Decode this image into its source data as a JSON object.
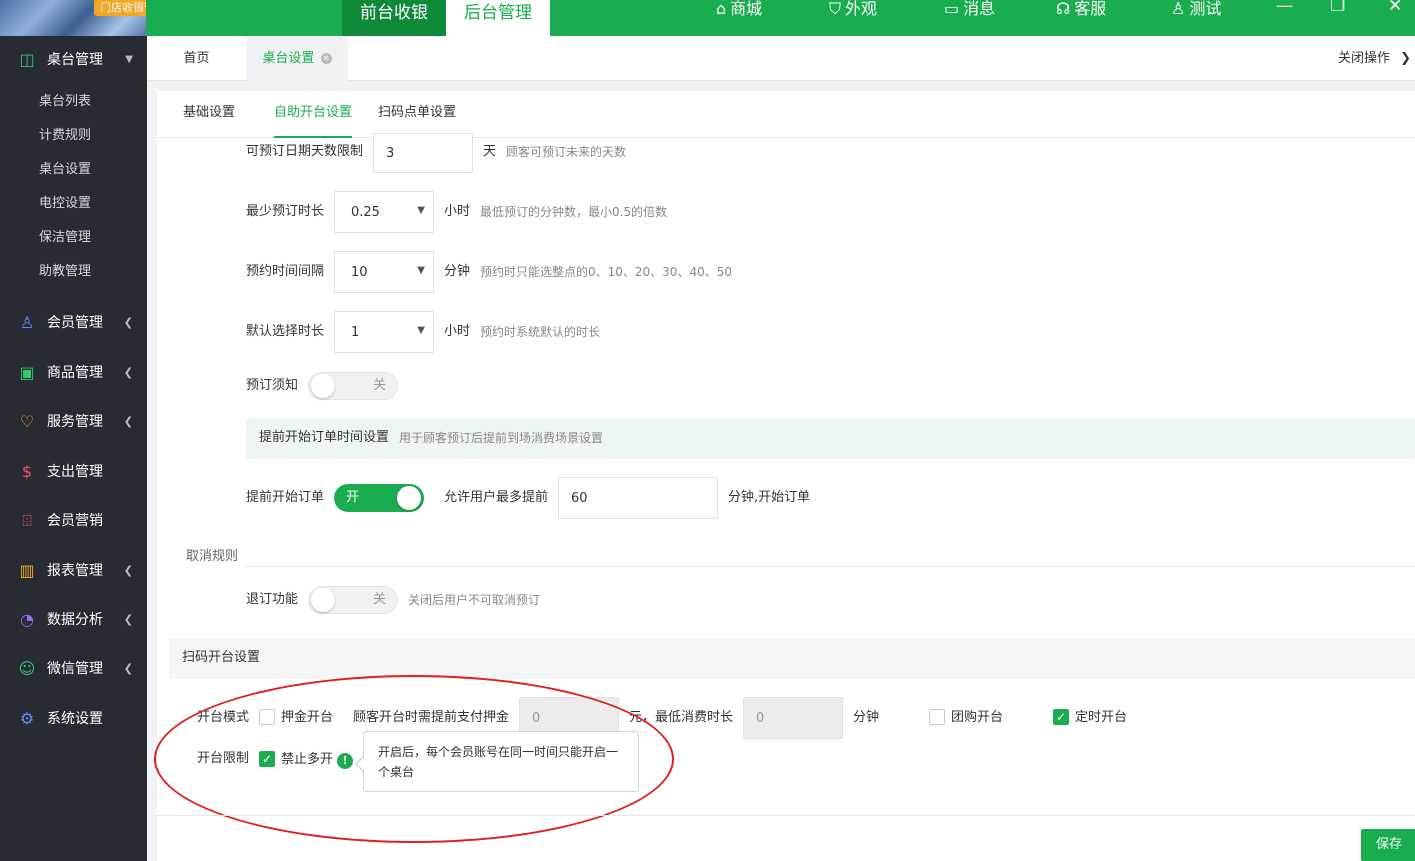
{
  "topbar": {
    "logo_text": "门店收银管理系统",
    "tab_front": "前台收银",
    "tab_back": "后台管理",
    "nav": [
      {
        "icon": "bag-icon",
        "glyph": "⌂",
        "label": "商城"
      },
      {
        "icon": "shirt-icon",
        "glyph": "👕",
        "label": "外观"
      },
      {
        "icon": "message-icon",
        "glyph": "💬",
        "label": "消息"
      },
      {
        "icon": "headset-icon",
        "glyph": "☊",
        "label": "客服"
      },
      {
        "icon": "user-icon",
        "glyph": "👤",
        "label": "测试"
      }
    ]
  },
  "sidebar": {
    "group_title": "桌台管理",
    "sub_items": [
      "桌台列表",
      "计费规则",
      "桌台设置",
      "电控设置",
      "保洁管理",
      "助教管理"
    ],
    "menus": [
      {
        "label": "会员管理",
        "icon": "members-icon",
        "glyph": "👥",
        "color": "#5b8ff9",
        "arrow": true
      },
      {
        "label": "商品管理",
        "icon": "goods-icon",
        "glyph": "▣",
        "color": "#2ecc71",
        "arrow": true
      },
      {
        "label": "服务管理",
        "icon": "service-icon",
        "glyph": "♥",
        "color": "#f5a623",
        "arrow": true
      },
      {
        "label": "支出管理",
        "icon": "expense-icon",
        "glyph": "$",
        "color": "#e8506b",
        "arrow": false
      },
      {
        "label": "会员营销",
        "icon": "gift-icon",
        "glyph": "🎁",
        "color": "#e8506b",
        "arrow": false
      },
      {
        "label": "报表管理",
        "icon": "report-icon",
        "glyph": "▥",
        "color": "#f5a623",
        "arrow": true
      },
      {
        "label": "数据分析",
        "icon": "pie-icon",
        "glyph": "◔",
        "color": "#9b6bf0",
        "arrow": true
      },
      {
        "label": "微信管理",
        "icon": "wechat-icon",
        "glyph": "☺",
        "color": "#2ecc71",
        "arrow": true
      },
      {
        "label": "系统设置",
        "icon": "settings-icon",
        "glyph": "⚙",
        "color": "#5b8ff9",
        "arrow": false
      }
    ]
  },
  "page_tabs": {
    "home": "首页",
    "current": "桌台设置",
    "close_ops": "关闭操作"
  },
  "sub_tabs": [
    "基础设置",
    "自助开台设置",
    "扫码点单设置"
  ],
  "form": {
    "reserve_days": {
      "label": "可预订日期天数限制",
      "value": "3",
      "unit": "天",
      "hint": "顾客可预订未来的天数"
    },
    "min_duration": {
      "label": "最少预订时长",
      "value": "0.25",
      "unit": "小时",
      "hint": "最低预订的分钟数，最小0.5的倍数"
    },
    "interval": {
      "label": "预约时间间隔",
      "value": "10",
      "unit": "分钟",
      "hint": "预约时只能选整点的0、10、20、30、40、50"
    },
    "default_duration": {
      "label": "默认选择时长",
      "value": "1",
      "unit": "小时",
      "hint": "预约时系统默认的时长"
    },
    "notice": {
      "label": "预订须知",
      "state": "关"
    },
    "advance_banner": {
      "title": "提前开始订单时间设置",
      "desc": "用于顾客预订后提前到场消费场景设置"
    },
    "advance_start": {
      "label": "提前开始订单",
      "state": "开",
      "allow_label": "允许用户最多提前",
      "value": "60",
      "unit": "分钟,开始订单"
    },
    "cancel_section": "取消规则",
    "refund": {
      "label": "退订功能",
      "state": "关",
      "hint": "关闭后用户不可取消预订"
    },
    "scan_section": "扫码开台设置",
    "open_mode": {
      "label": "开台模式",
      "deposit": "押金开台",
      "deposit_desc": "顾客开台时需提前支付押金",
      "deposit_value": "0",
      "deposit_unit": "元，最低消费时长",
      "min_value": "0",
      "min_unit": "分钟",
      "group": "团购开台",
      "timed": "定时开台"
    },
    "open_limit": {
      "label": "开台限制",
      "option": "禁止多开",
      "tooltip": "开启后，每个会员账号在同一时间只能开启一个桌台"
    }
  },
  "save_label": "保存",
  "colors": {
    "brand": "#1aad4f",
    "sidebar": "#282b33",
    "annotation": "#e02020"
  }
}
